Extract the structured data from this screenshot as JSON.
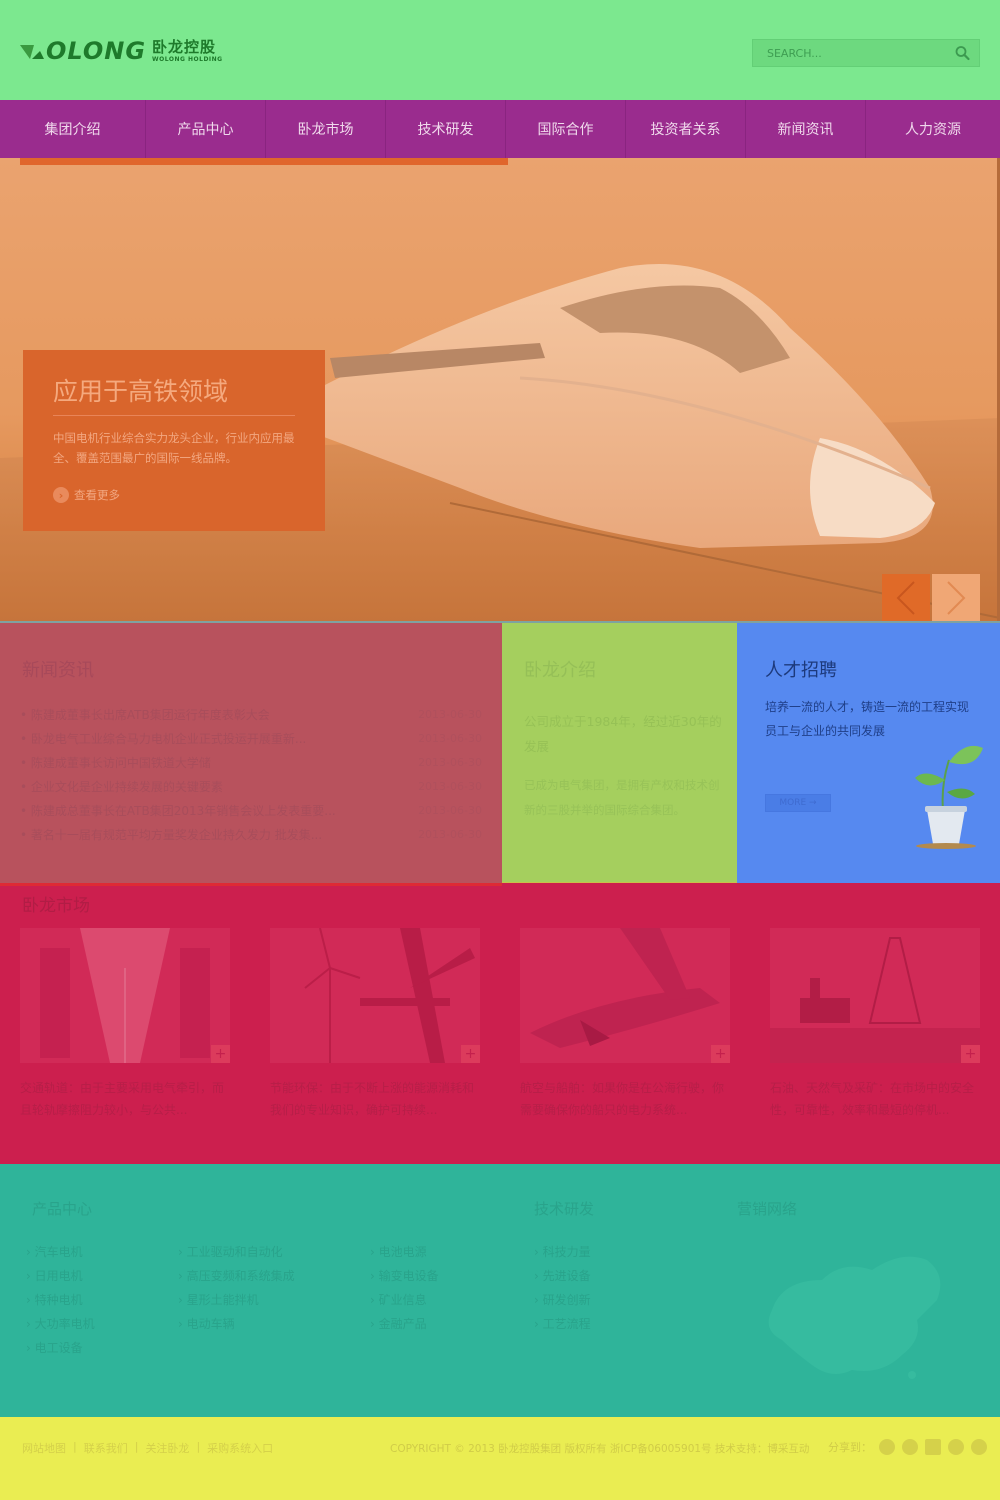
{
  "header": {
    "logo_word": "OLONG",
    "logo_cn": "卧龙控股",
    "logo_en": "WOLONG HOLDING",
    "search_placeholder": "SEARCH..."
  },
  "nav": {
    "items": [
      "集团介绍",
      "产品中心",
      "卧龙市场",
      "技术研发",
      "国际合作",
      "投资者关系",
      "新闻资讯",
      "人力资源"
    ]
  },
  "banner": {
    "title": "应用于高铁领域",
    "body": "中国电机行业综合实力龙头企业，行业内应用最全、覆盖范围最广的国际一线品牌。",
    "more": "查看更多"
  },
  "news": {
    "title": "新闻资讯",
    "items": [
      {
        "text": "陈建成董事长出席ATB集团运行年度表彰大会",
        "date": "2013-06-30"
      },
      {
        "text": "卧龙电气工业综合马力电机企业正式投运开展重新...",
        "date": "2013-06-30"
      },
      {
        "text": "陈建成董事长访问中国铁道大学储",
        "date": "2013-06-30"
      },
      {
        "text": "企业文化是企业持续发展的关键要素",
        "date": "2013-06-30"
      },
      {
        "text": "陈建成总董事长在ATB集团2013年销售会议上发表重要...",
        "date": "2013-06-30"
      },
      {
        "text": "著名十一届有规范平均方量奖发企业持久发力 批发集...",
        "date": "2013-06-30"
      }
    ]
  },
  "about": {
    "title": "卧龙介绍",
    "lead": "公司成立于1984年，经过近30年的发展",
    "body": "已成为电气集团，是拥有产权和技术创新的三股并举的国际综合集团。"
  },
  "jobs": {
    "title": "人才招聘",
    "body": "培养一流的人才，铸造一流的工程实现员工与企业的共同发展",
    "more": "MORE →"
  },
  "market": {
    "title": "卧龙市场",
    "cards": [
      {
        "text": "交通轨道：由于主要采用电气牵引，而且轮轨摩擦阻力较小，与公共..."
      },
      {
        "text": "节能环保：由于不断上涨的能源消耗和我们的专业知识，确护可持续..."
      },
      {
        "text": "航空与船舶：如果你是在公海行驶，你需要确保你的船只的电力系统..."
      },
      {
        "text": "石油、天然气及采矿：在市场中的安全性，可靠性，效率和最短的停机..."
      }
    ],
    "plus": "+"
  },
  "footer_nav": {
    "products_title": "产品中心",
    "products_col1": [
      "汽车电机",
      "日用电机",
      "特种电机",
      "大功率电机",
      "电工设备"
    ],
    "products_col2": [
      "工业驱动和自动化",
      "高压变频和系统集成",
      "星形土能拌机",
      "电动车辆"
    ],
    "products_col3": [
      "电池电源",
      "输变电设备",
      "矿业信息",
      "金融产品"
    ],
    "tech_title": "技术研发",
    "tech_items": [
      "科技力量",
      "先进设备",
      "研发创新",
      "工艺流程"
    ],
    "network_title": "营销网络"
  },
  "bottom": {
    "links": [
      "网站地图",
      "联系我们",
      "关注卧龙",
      "采购系统入口"
    ],
    "copyright": "COPYRIGHT © 2013 卧龙控股集团 版权所有 浙ICP备06005901号 技术支持：博采互动",
    "share_label": "分享到：",
    "share_icons": [
      "weibo-icon",
      "tencent-weibo-icon",
      "qzone-icon",
      "renren-icon",
      "kaixin-icon"
    ]
  },
  "colors": {
    "header": "#7ce88f",
    "nav": "#9a2c8e",
    "banner": "#e6995f",
    "news": "#b8525d",
    "about": "#a5cf5e",
    "jobs": "#5689f0",
    "market": "#cc1f4e",
    "footer_nav": "#2fb49a",
    "bottom": "#eaed52"
  }
}
